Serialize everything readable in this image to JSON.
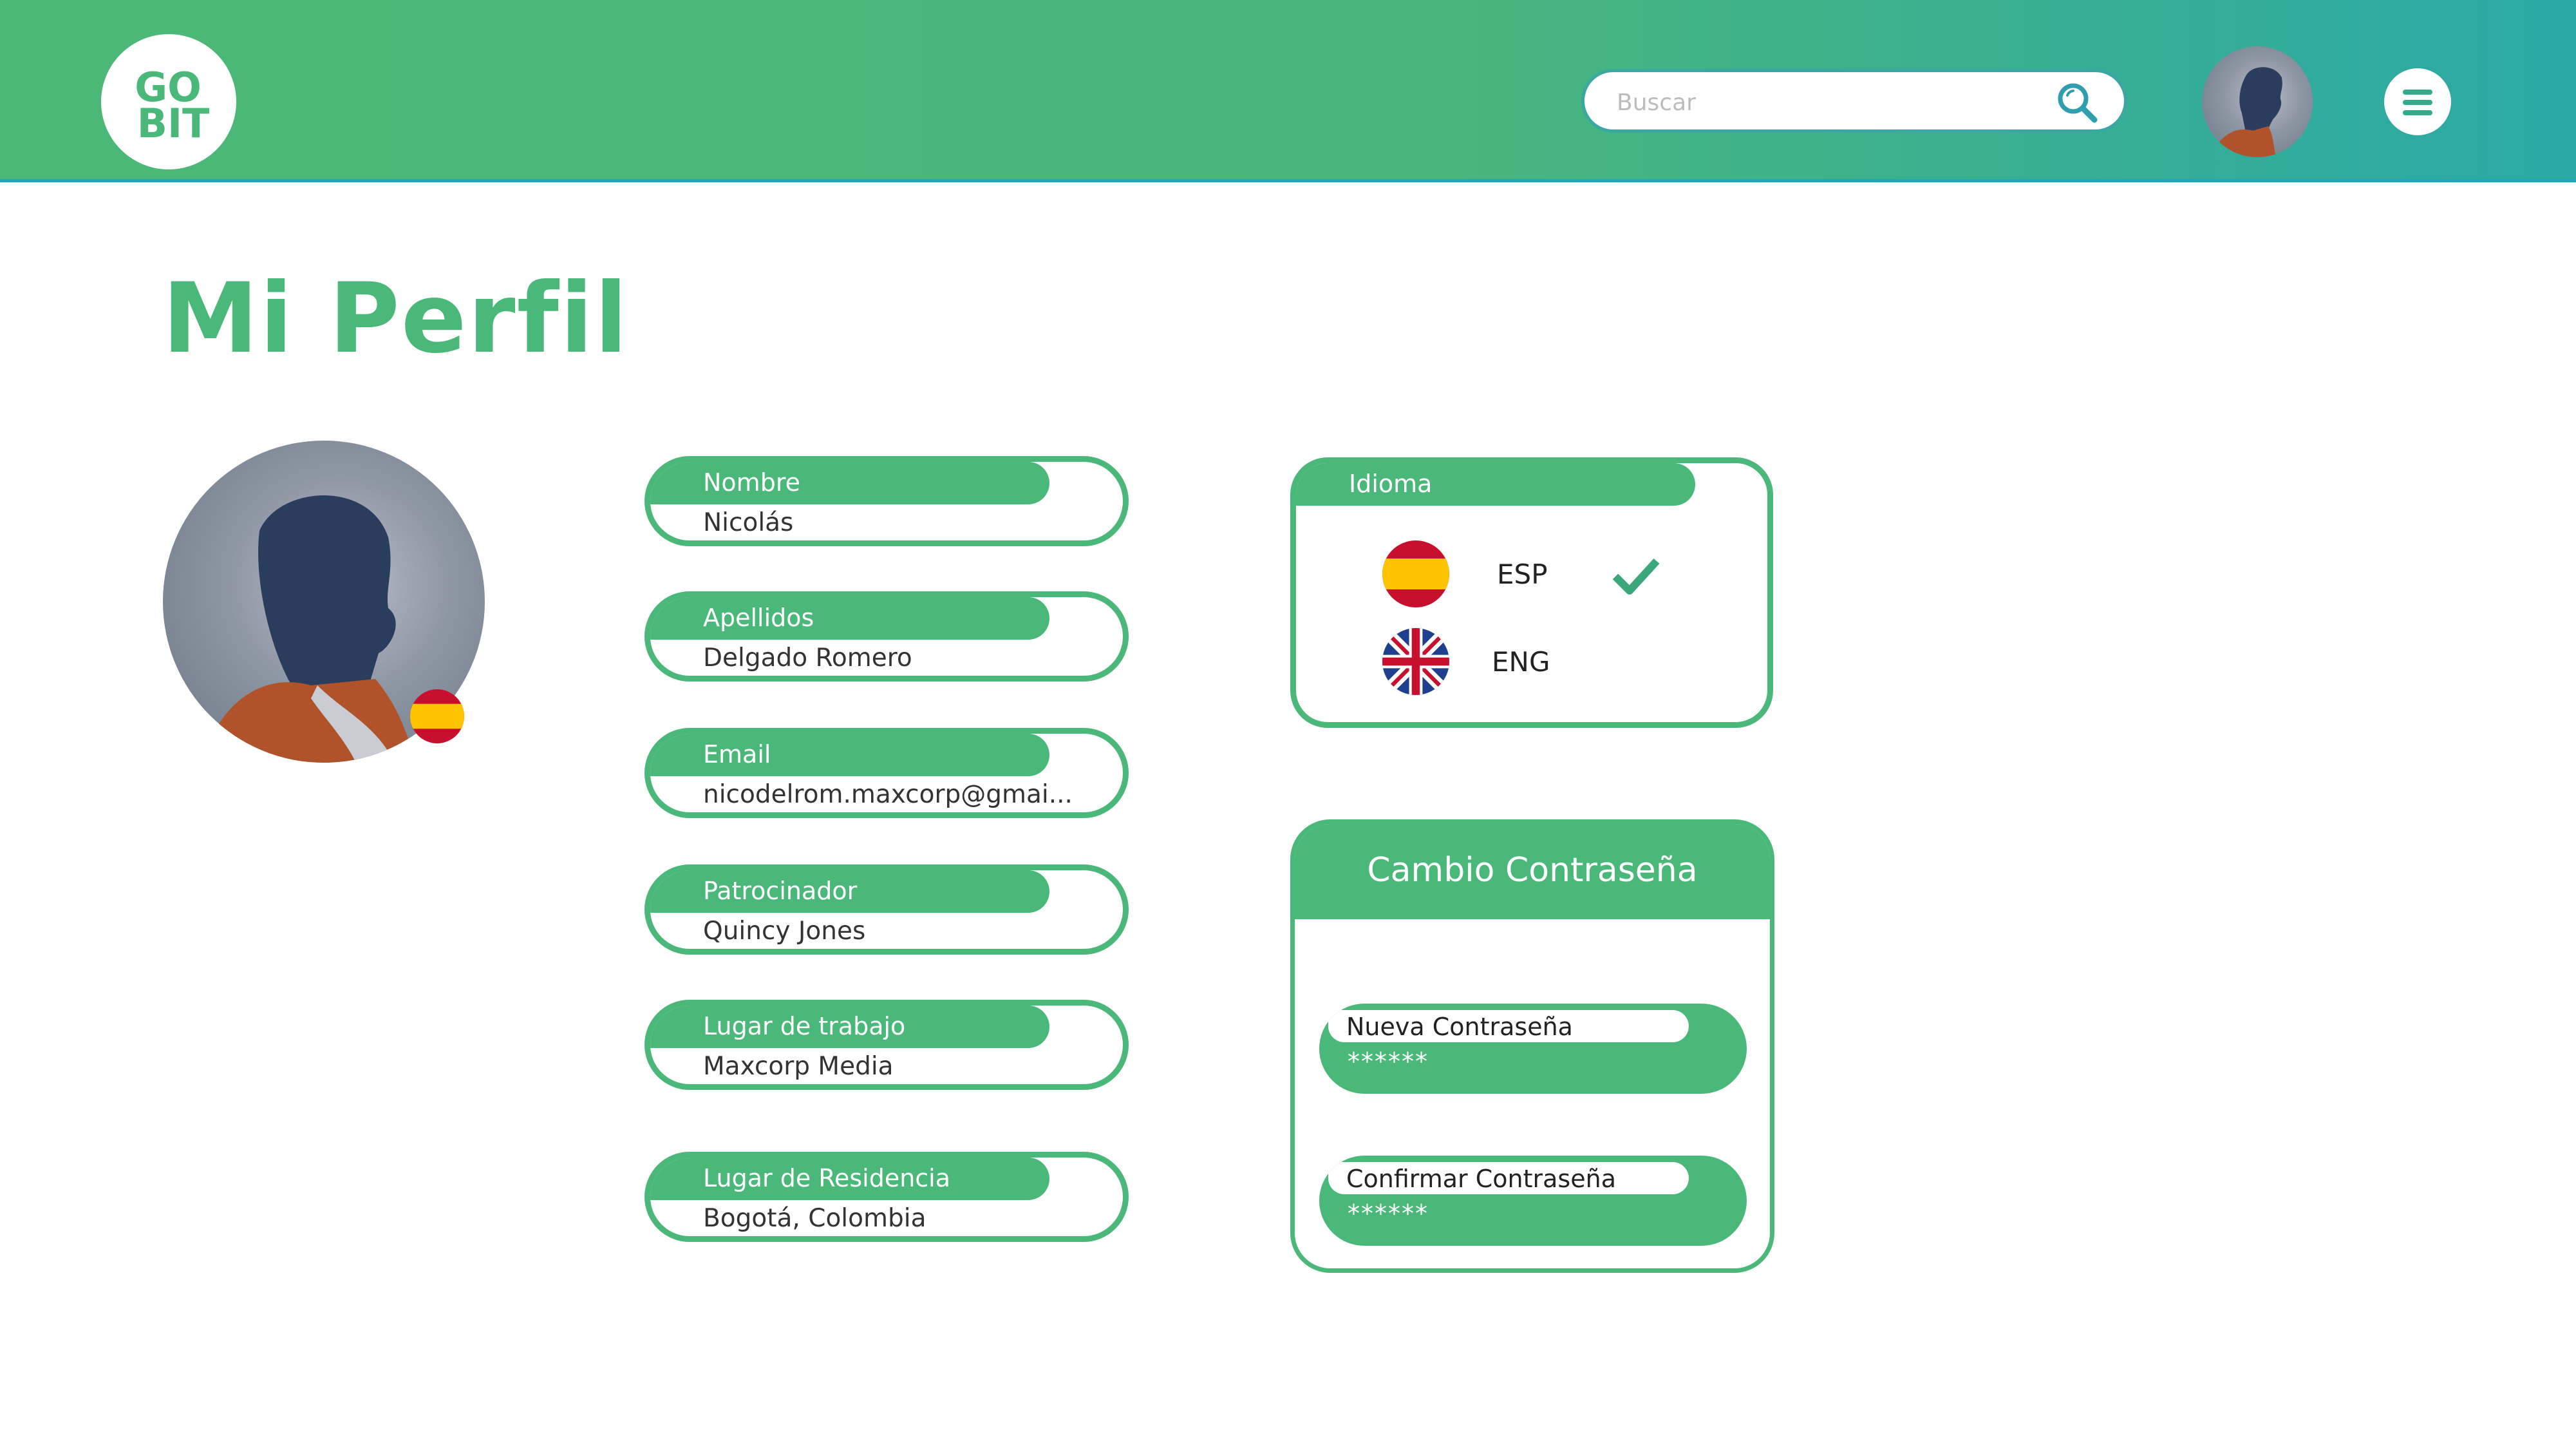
{
  "header": {
    "logo_text_top": "GO",
    "logo_text_bottom": "BIT",
    "search": {
      "placeholder": "Buscar",
      "value": ""
    },
    "icons": {
      "search": "search-icon",
      "menu": "hamburger-menu-icon",
      "avatar": "user-avatar"
    }
  },
  "page": {
    "title": "Mi Perfil"
  },
  "profile": {
    "flag": "spain-flag-icon",
    "fields": [
      {
        "label": "Nombre",
        "value": "Nicolás"
      },
      {
        "label": "Apellidos",
        "value": "Delgado Romero"
      },
      {
        "label": "Email",
        "value": "nicodelrom.maxcorp@gmai..."
      },
      {
        "label": "Patrocinador",
        "value": "Quincy Jones"
      },
      {
        "label": "Lugar de trabajo",
        "value": "Maxcorp Media"
      },
      {
        "label": "Lugar de Residencia",
        "value": "Bogotá, Colombia"
      }
    ]
  },
  "language": {
    "label": "Idioma",
    "options": [
      {
        "code": "ESP",
        "flag": "spain-flag-icon",
        "selected": true
      },
      {
        "code": "ENG",
        "flag": "uk-flag-icon",
        "selected": false
      }
    ]
  },
  "password": {
    "title": "Cambio Contraseña",
    "new_label": "Nueva Contraseña",
    "new_value": "******",
    "confirm_label": "Confirmar Contraseña",
    "confirm_value": "******"
  },
  "colors": {
    "primary": "#4ab879",
    "header_end": "#2aa9a6",
    "text": "#333333"
  }
}
